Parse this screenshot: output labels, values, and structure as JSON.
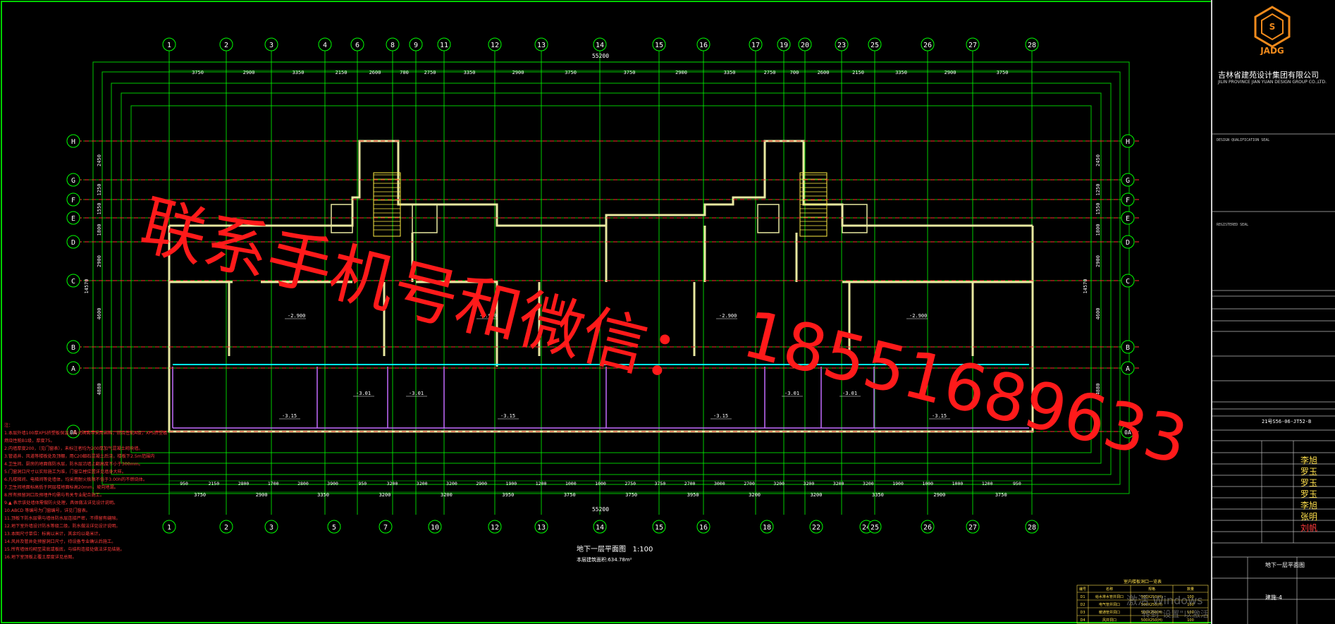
{
  "axes_top": [
    "1",
    "2",
    "3",
    "4",
    "6",
    "8",
    "9",
    "11",
    "12",
    "13",
    "14",
    "15",
    "16",
    "17",
    "19",
    "20",
    "23",
    "25",
    "26",
    "27",
    "28"
  ],
  "axes_bottom": [
    "1",
    "2",
    "3",
    "5",
    "7",
    "10",
    "12",
    "13",
    "14",
    "15",
    "16",
    "18",
    "22",
    "24",
    "25",
    "26",
    "27",
    "28"
  ],
  "axes_rows": [
    "H",
    "G",
    "F",
    "E",
    "D",
    "C",
    "B",
    "A",
    "0A"
  ],
  "dim_total": "55200",
  "dims_top": [
    "3750",
    "2900",
    "3350",
    "2150",
    "2600",
    "700",
    "2750",
    "3350",
    "2900",
    "3750",
    "3750",
    "2900",
    "3350",
    "2750",
    "700",
    "2600",
    "2150",
    "3350",
    "2900",
    "3750"
  ],
  "dims_bottom": [
    "950",
    "2150",
    "2800",
    "1700",
    "2800",
    "3900",
    "950",
    "3200",
    "3200",
    "3200",
    "2900",
    "1900",
    "1200",
    "1000",
    "1000",
    "2750",
    "3750",
    "2700",
    "3000",
    "2700",
    "3200",
    "3200",
    "3200",
    "3200",
    "1900",
    "1000",
    "1000",
    "1200",
    "950"
  ],
  "dims_bottom2": [
    "3750",
    "2900",
    "3350",
    "3200",
    "3200",
    "3950",
    "3750",
    "3750",
    "3950",
    "3200",
    "3200",
    "3350",
    "2900",
    "3750"
  ],
  "dims_left": [
    "2450",
    "1250",
    "1550",
    "1800",
    "2900",
    "4600",
    "4880",
    "14570"
  ],
  "dims_right": [
    "2450",
    "1250",
    "1550",
    "1800",
    "2900",
    "4600",
    "4880",
    "14570"
  ],
  "levels": [
    "-2.900",
    "-2.900",
    "-2.900",
    "-2.900",
    "-3.01",
    "-3.01",
    "-3.01",
    "-3.01",
    "-3.15",
    "-3.15",
    "-3.15",
    "-3.15"
  ],
  "overlay": {
    "line1": "联系手机号和微信：",
    "line2": "18551689633"
  },
  "title_block": {
    "company_cn": "吉林省建苑设计集团有限公司",
    "company_en": "JILIN PROVINCE JIAN YUAN DESIGN GROUP CO.,LTD.",
    "logo_text": "JADG",
    "seal_label": "DESIGN QUALIFICATION SEAL",
    "registered_seal": "REGISTERED SEAL",
    "project_code": "21号S56-06-JT52-B",
    "signatures": [
      "李旭",
      "罗玉",
      "罗玉",
      "罗玉",
      "李旭",
      "张明",
      "刘帆"
    ],
    "sheet_name": "地下一层平面图",
    "sheet_no": "建施-4",
    "scale_label": "1:100"
  },
  "drawing": {
    "title": "地下一层平面图",
    "scale": "1:100",
    "area": "本层建筑面积:634.78m²"
  },
  "notes": [
    "注：",
    "1.本层外墙100厚XPS挤塑板保温，防火隔离带采用岩棉，燃烧性能A级，XPS挤塑板",
    "  燃烧性能B1级，厚度75。",
    "2.内墙厚度200，（见门窗表），未标注者均为200厚加气混凝土砌块墙。",
    "3.管道井、风道等楼板处及顶棚，用C20细石混凝土后浇，楼板下2.5m范围内",
    "4.卫生间、厨房的地面做防水层，防水层沿墙上翻高度不小于300mm。",
    "5.门窗洞口尺寸以实际施工为准，门窗立樘位置详见墙身大样。",
    "6.凡楼梯间、电梯间等处墙体，均采用耐火极限不低于3.00h的不燃烧体。",
    "7.卫生间地面标高低于同层楼地面标高20mm，坡向地漏。",
    "8.所有预留洞口及预埋件均需与有关专业配合施工。",
    "9.▲ 表示该处墙体需做防火处理，具体做法详见设计说明。",
    "10.ABCD 等编号为门窗编号，详见门窗表。",
    "11.顶板下防水层需与墙体防水层连接严密，不得留有缝隙。",
    "12.地下室外墙设计防水等级二级，防水做法详见设计说明。",
    "13.本图尺寸单位：标高以米计，其余均以毫米计。",
    "14.风井及管井处预留洞口尺寸，待设备专业确认后施工。",
    "15.所有墙体均砌至梁底或板底，与结构连接处做法详见结施。",
    "16.地下室顶板上覆土厚度详见总图。"
  ],
  "schedule": {
    "title": "室内楼板洞口一览表",
    "headers": [
      "编号",
      "名称",
      "规格",
      "数量"
    ],
    "rows": [
      [
        "D1",
        "给水排水管井洞口",
        "500X250(H)",
        "100"
      ],
      [
        "D2",
        "电气管井洞口",
        "500X250(H)",
        "100"
      ],
      [
        "D3",
        "暖通管井洞口",
        "500X250(H)",
        "100"
      ],
      [
        "D4",
        "风井洞口",
        "500X250(H)",
        "100"
      ]
    ]
  },
  "watermark": {
    "line1": "激活 Windows",
    "line2": "转到\"设置\"以激活 Windows。"
  },
  "colors": {
    "grid": "#00ff00",
    "axis_red": "#ff3030",
    "wall": "#ffffff",
    "wall_fill": "#e8e8a0",
    "stair": "#ffee44",
    "cyan": "#00ffff",
    "magenta": "#d36bff",
    "overlay_red": "#ff1a1a"
  }
}
